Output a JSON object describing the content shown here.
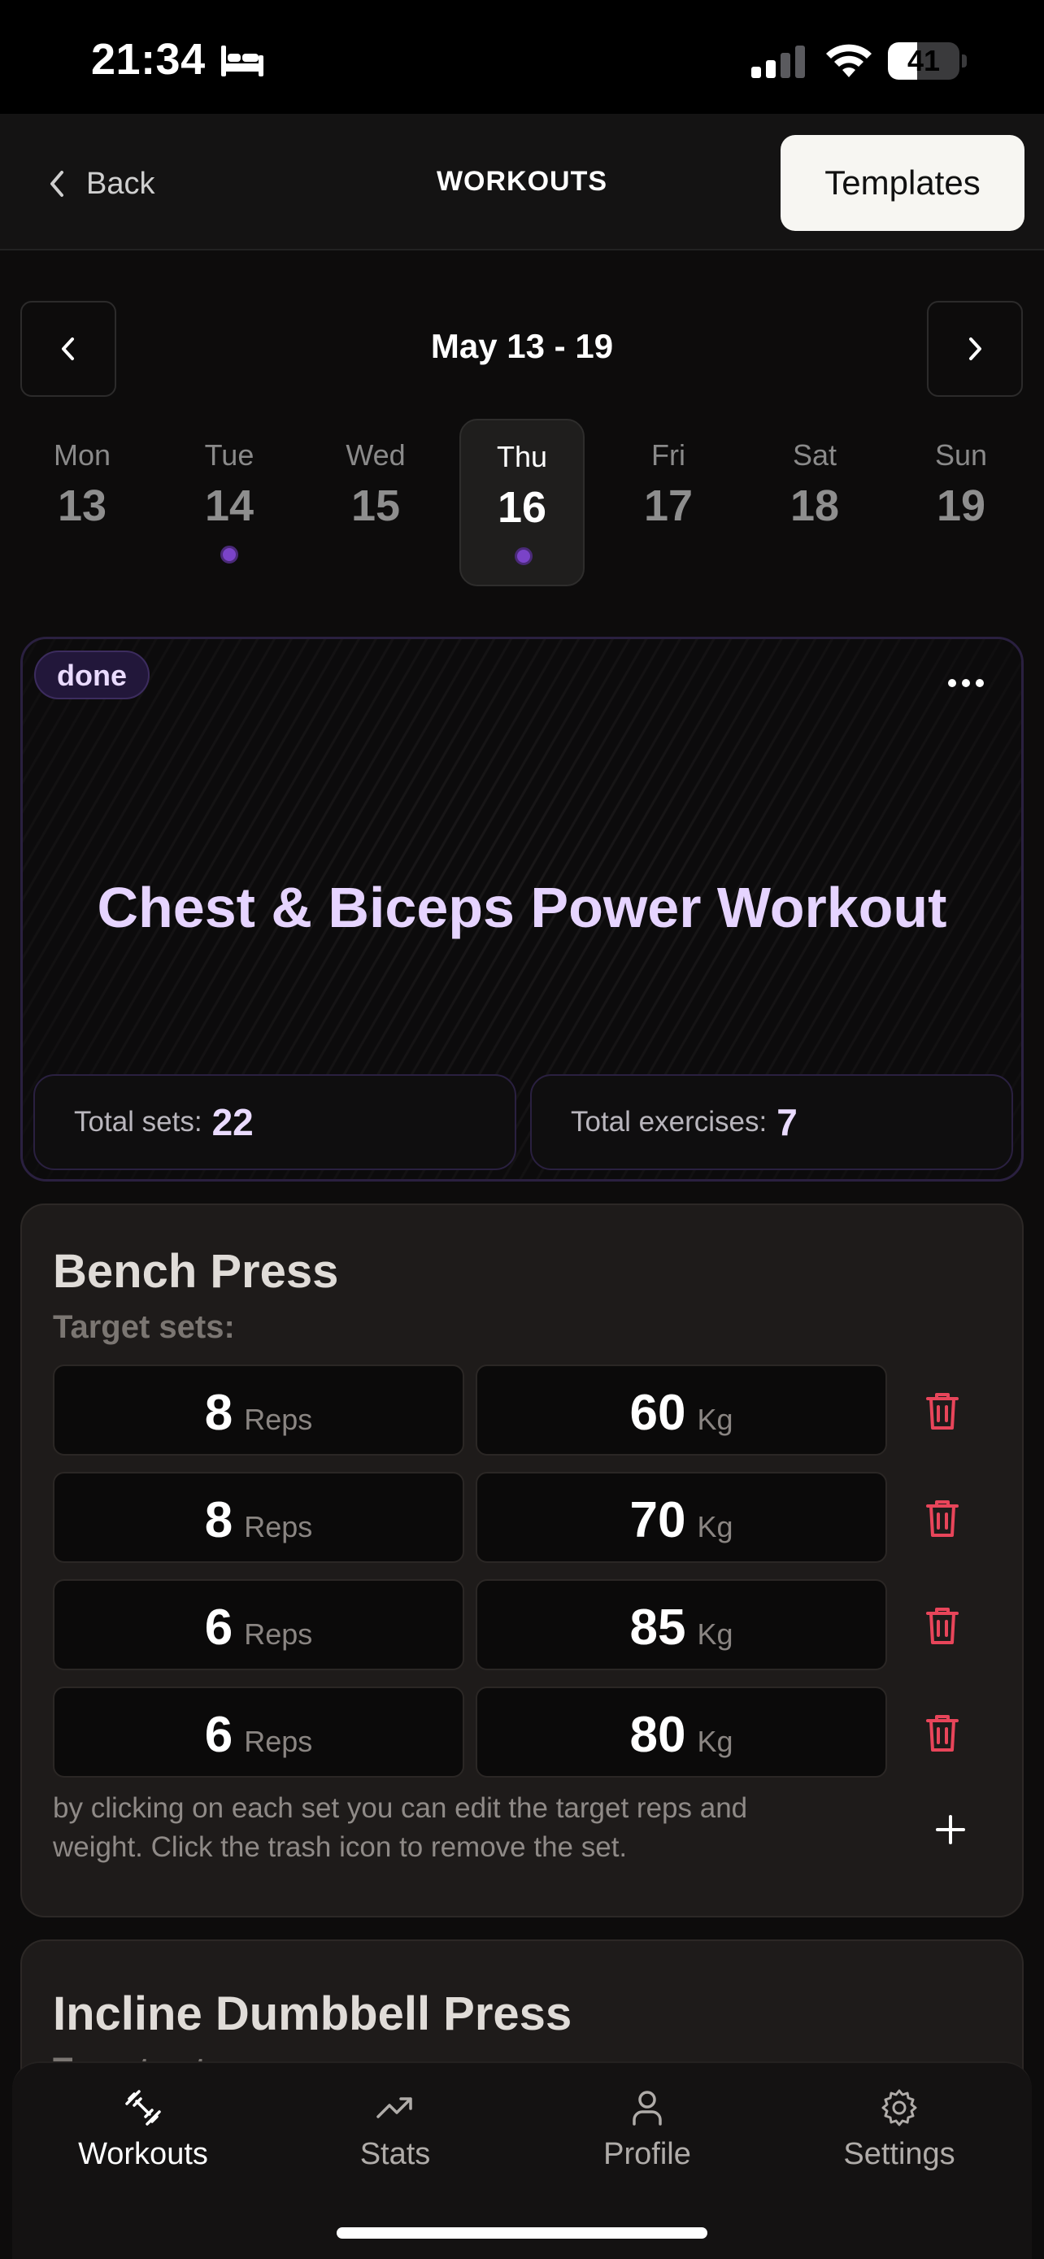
{
  "status_bar": {
    "time": "21:34",
    "focus_icon": "bed-icon",
    "battery_level": "41",
    "battery_fraction": 0.41
  },
  "nav": {
    "back_label": "Back",
    "title": "WORKOUTS",
    "templates_label": "Templates"
  },
  "week": {
    "range": "May 13 - 19",
    "days": [
      {
        "name": "Mon",
        "num": "13",
        "has_workout": false,
        "selected": false
      },
      {
        "name": "Tue",
        "num": "14",
        "has_workout": true,
        "selected": false
      },
      {
        "name": "Wed",
        "num": "15",
        "has_workout": false,
        "selected": false
      },
      {
        "name": "Thu",
        "num": "16",
        "has_workout": true,
        "selected": true
      },
      {
        "name": "Fri",
        "num": "17",
        "has_workout": false,
        "selected": false
      },
      {
        "name": "Sat",
        "num": "18",
        "has_workout": false,
        "selected": false
      },
      {
        "name": "Sun",
        "num": "19",
        "has_workout": false,
        "selected": false
      }
    ]
  },
  "workout": {
    "status": "done",
    "title": "Chest & Biceps Power Workout",
    "total_sets_label": "Total sets:",
    "total_sets": "22",
    "total_exercises_label": "Total exercises:",
    "total_exercises": "7"
  },
  "exercises": [
    {
      "name": "Bench Press",
      "target_label": "Target sets:",
      "reps_unit": "Reps",
      "weight_unit": "Kg",
      "sets": [
        {
          "reps": "8",
          "weight": "60"
        },
        {
          "reps": "8",
          "weight": "70"
        },
        {
          "reps": "6",
          "weight": "85"
        },
        {
          "reps": "6",
          "weight": "80"
        }
      ],
      "hint": "by clicking on each set you can edit the target reps and weight. Click the trash icon to remove the set."
    },
    {
      "name": "Incline Dumbbell Press",
      "target_label": "Target sets:"
    }
  ],
  "tabs": [
    {
      "label": "Workouts",
      "icon": "dumbbell-icon",
      "active": true
    },
    {
      "label": "Stats",
      "icon": "trending-up-icon",
      "active": false
    },
    {
      "label": "Profile",
      "icon": "user-icon",
      "active": false
    },
    {
      "label": "Settings",
      "icon": "gear-icon",
      "active": false
    }
  ],
  "colors": {
    "accent": "#7a43c8",
    "title_lavender": "#e6d4ff",
    "trash_red": "#e8455a"
  }
}
